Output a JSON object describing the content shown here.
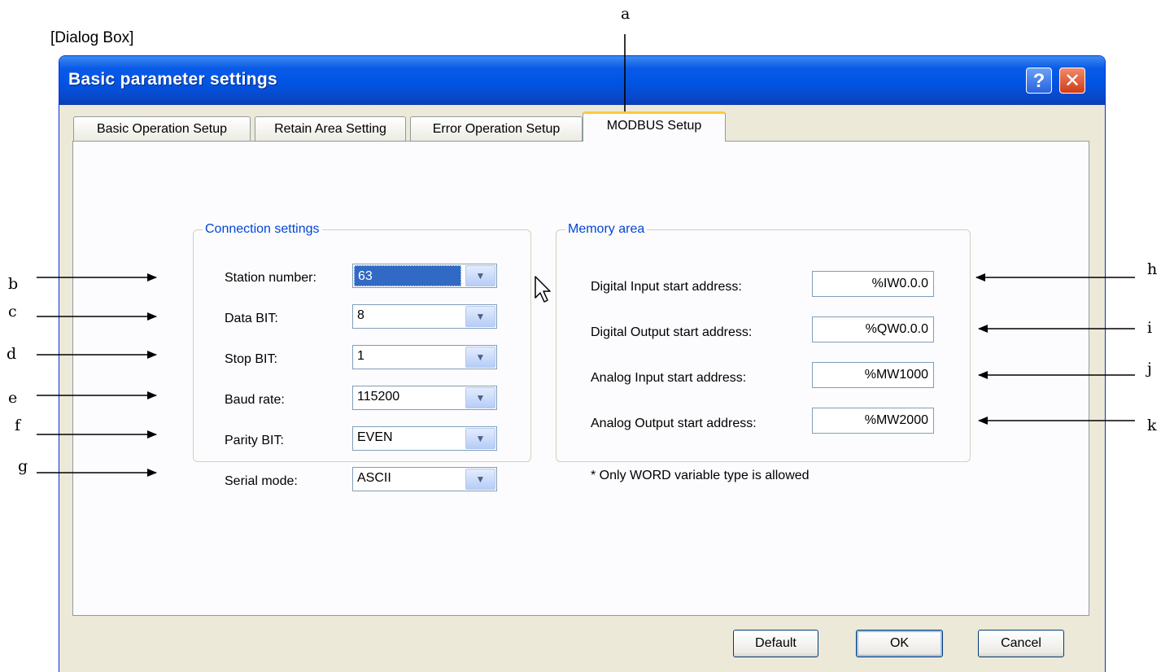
{
  "caption": "[Dialog Box]",
  "dialog": {
    "title": "Basic parameter settings",
    "help_glyph": "?",
    "close_glyph": "✕",
    "tabs": [
      {
        "label": "Basic Operation Setup",
        "active": false
      },
      {
        "label": "Retain Area Setting",
        "active": false
      },
      {
        "label": "Error Operation Setup",
        "active": false
      },
      {
        "label": "MODBUS Setup",
        "active": true
      }
    ],
    "connection": {
      "legend": "Connection settings",
      "fields": [
        {
          "label": "Station number:",
          "value": "63"
        },
        {
          "label": "Data BIT:",
          "value": "8"
        },
        {
          "label": "Stop BIT:",
          "value": "1"
        },
        {
          "label": "Baud rate:",
          "value": "115200"
        },
        {
          "label": "Parity BIT:",
          "value": "EVEN"
        },
        {
          "label": "Serial mode:",
          "value": "ASCII"
        }
      ]
    },
    "memory": {
      "legend": "Memory area",
      "fields": [
        {
          "label": "Digital Input start address:",
          "value": "%IW0.0.0"
        },
        {
          "label": "Digital Output start address:",
          "value": "%QW0.0.0"
        },
        {
          "label": "Analog Input start address:",
          "value": "%MW1000"
        },
        {
          "label": "Analog Output start address:",
          "value": "%MW2000"
        }
      ],
      "note": "* Only WORD variable type is allowed"
    },
    "buttons": {
      "default": "Default",
      "ok": "OK",
      "cancel": "Cancel"
    }
  },
  "annotations": {
    "a": "a",
    "b": "b",
    "c": "c",
    "d": "d",
    "e": "e",
    "f": "f",
    "g": "g",
    "h": "h",
    "i": "i",
    "j": "j",
    "k": "k"
  },
  "icons": {
    "dropdown": "chevron-down-icon",
    "help": "help-icon",
    "close": "close-icon",
    "cursor": "mouse-pointer-icon"
  }
}
